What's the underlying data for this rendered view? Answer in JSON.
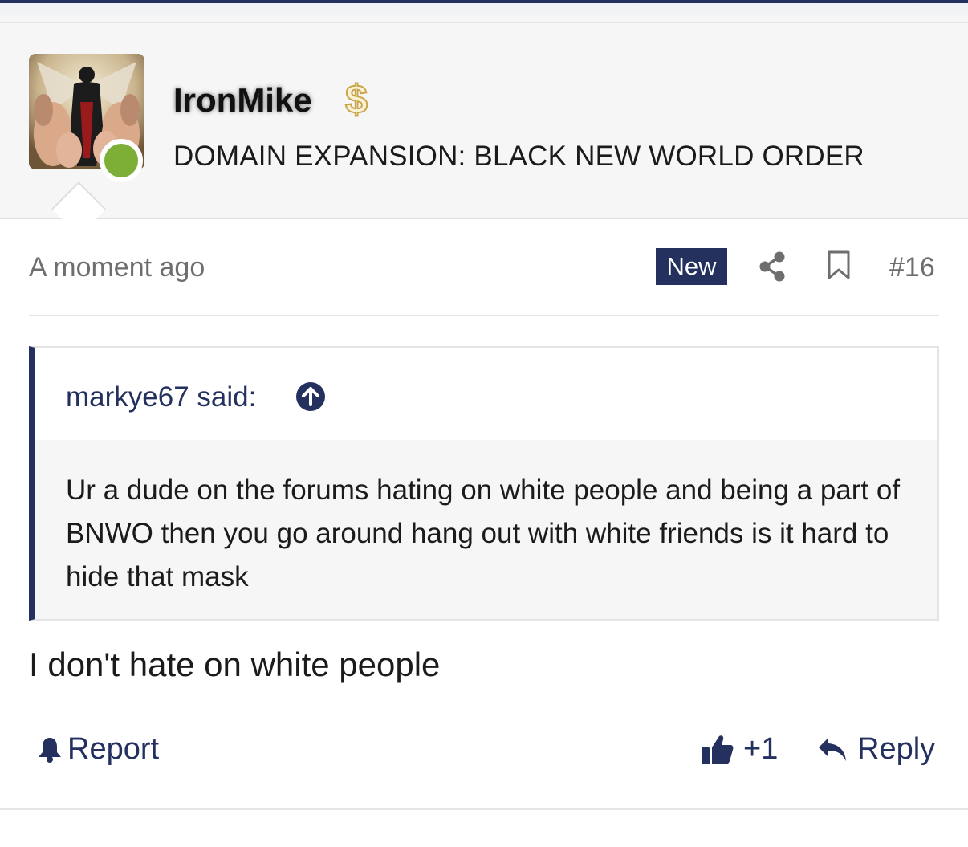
{
  "post": {
    "username": "IronMike",
    "user_title": "DOMAIN EXPANSION: BLACK NEW WORLD ORDER",
    "avatar_icon": "user-avatar-image",
    "online_status_color": "#7dae35",
    "badge_icon": "dollar-sign-icon",
    "timestamp": "A moment ago",
    "new_badge": "New",
    "post_number": "#16",
    "quote": {
      "author_label": "markye67 said:",
      "text": "Ur a dude on the forums hating on white people and being a part of BNWO then you go around hang out with white friends is it hard to hide that mask"
    },
    "message": "I don't hate on white people",
    "actions": {
      "report_label": "Report",
      "like_label": "+1",
      "reply_label": "Reply"
    }
  },
  "colors": {
    "accent": "#24305e",
    "header_bg": "#f6f6f6",
    "quote_bg": "#f6f6f6",
    "muted_text": "#6e6e6e"
  }
}
